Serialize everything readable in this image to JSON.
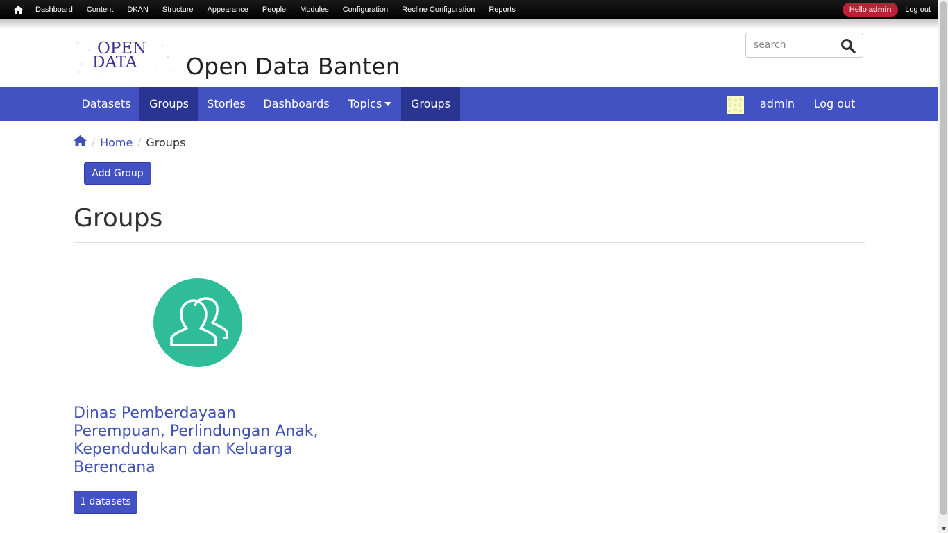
{
  "toolbar": {
    "home_icon": "home-icon",
    "links": [
      "Dashboard",
      "Content",
      "DKAN",
      "Structure",
      "Appearance",
      "People",
      "Modules",
      "Configuration",
      "Recline Configuration",
      "Reports"
    ],
    "hello_prefix": "Hello",
    "hello_user": "admin",
    "logout": "Log out"
  },
  "header": {
    "logo_line1": "OPEN",
    "logo_line2": "DATA",
    "site_name": "Open Data Banten",
    "search_placeholder": "search",
    "search_icon": "search-icon"
  },
  "nav": {
    "items": [
      {
        "label": "Datasets",
        "active": false
      },
      {
        "label": "Groups",
        "active": true
      },
      {
        "label": "Stories",
        "active": false
      },
      {
        "label": "Dashboards",
        "active": false
      },
      {
        "label": "Topics",
        "active": false,
        "dropdown": true
      },
      {
        "label": "Groups",
        "active": true
      }
    ],
    "user": "admin",
    "logout": "Log out"
  },
  "breadcrumb": {
    "home_icon": "home-icon",
    "items": [
      "Home",
      "Groups"
    ]
  },
  "actions": {
    "add_group": "Add Group"
  },
  "page": {
    "title": "Groups"
  },
  "groups": [
    {
      "title": "Dinas Pemberdayaan Perempuan, Perlindungan Anak, Kependudukan dan Keluarga Berencana",
      "datasets": "1 datasets",
      "icon": "group-users-icon"
    }
  ],
  "colors": {
    "toolbar_bg": "#000000",
    "nav_bg": "#4252c2",
    "nav_active": "#2a3591",
    "accent": "#3f51b5",
    "group_icon_bg": "#2ebd98",
    "hello_badge": "#bf1f35"
  }
}
